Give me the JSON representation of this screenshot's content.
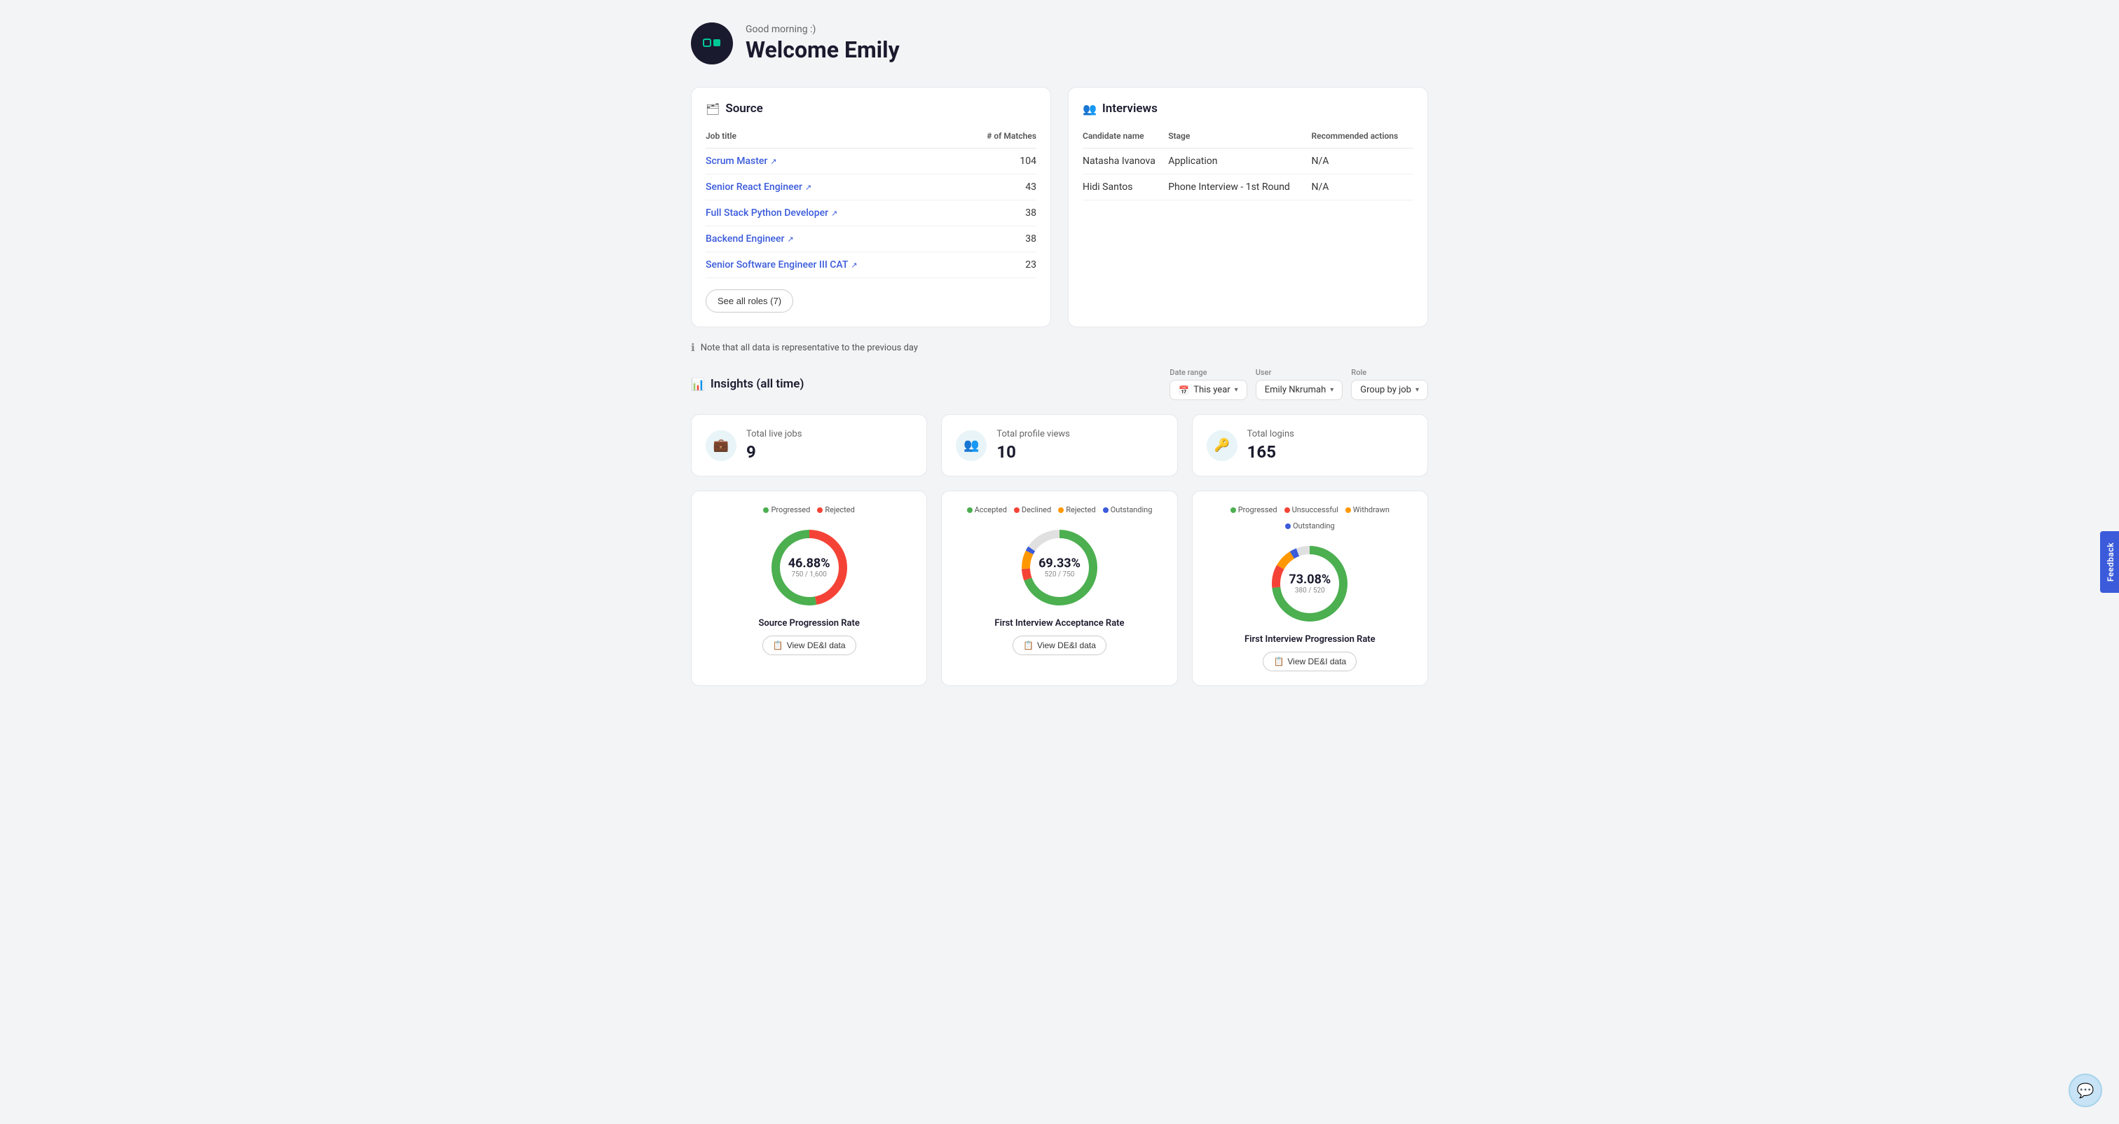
{
  "header": {
    "greeting": "Good morning :)",
    "welcome": "Welcome Emily",
    "logo_alt": "app logo"
  },
  "source_section": {
    "title": "Source",
    "table": {
      "col1": "Job title",
      "col2": "# of Matches",
      "rows": [
        {
          "title": "Scrum Master",
          "matches": "104"
        },
        {
          "title": "Senior React Engineer",
          "matches": "43"
        },
        {
          "title": "Full Stack Python Developer",
          "matches": "38"
        },
        {
          "title": "Backend Engineer",
          "matches": "38"
        },
        {
          "title": "Senior Software Engineer III CAT",
          "matches": "23"
        }
      ]
    },
    "see_all_btn": "See all roles (7)"
  },
  "interviews_section": {
    "title": "Interviews",
    "table": {
      "col1": "Candidate name",
      "col2": "Stage",
      "col3": "Recommended actions",
      "rows": [
        {
          "name": "Natasha Ivanova",
          "stage": "Application",
          "action": "N/A"
        },
        {
          "name": "Hidi Santos",
          "stage": "Phone Interview - 1st Round",
          "action": "N/A"
        }
      ]
    }
  },
  "note": "Note that all data is representative to the previous day",
  "insights": {
    "title": "Insights (all time)",
    "filters": {
      "date_range_label": "Date range",
      "date_range_value": "This year",
      "user_label": "User",
      "user_value": "Emily Nkrumah",
      "role_label": "Role",
      "role_value": "Group by job"
    },
    "stats": [
      {
        "label": "Total live jobs",
        "value": "9",
        "icon": "briefcase"
      },
      {
        "label": "Total profile views",
        "value": "10",
        "icon": "people"
      },
      {
        "label": "Total logins",
        "value": "165",
        "icon": "login"
      }
    ],
    "charts": [
      {
        "id": "source",
        "legend": [
          {
            "label": "Progressed",
            "color": "#4caf50"
          },
          {
            "label": "Rejected",
            "color": "#f44336"
          }
        ],
        "percentage": "46.88%",
        "sub": "750 / 1,600",
        "title": "Source Progression Rate",
        "btn": "View DE&I data",
        "segments": [
          {
            "pct": 46.88,
            "color": "#f44336"
          },
          {
            "pct": 53.12,
            "color": "#4caf50"
          }
        ]
      },
      {
        "id": "first_interview_acceptance",
        "legend": [
          {
            "label": "Accepted",
            "color": "#4caf50"
          },
          {
            "label": "Declined",
            "color": "#f44336"
          },
          {
            "label": "Rejected",
            "color": "#ff9800"
          },
          {
            "label": "Outstanding",
            "color": "#3b5bdb"
          }
        ],
        "percentage": "69.33%",
        "sub": "520 / 750",
        "title": "First Interview Acceptance Rate",
        "btn": "View DE&I data",
        "segments": [
          {
            "pct": 69.33,
            "color": "#4caf50"
          },
          {
            "pct": 5,
            "color": "#f44336"
          },
          {
            "pct": 8,
            "color": "#ff9800"
          },
          {
            "pct": 2,
            "color": "#3b5bdb"
          },
          {
            "pct": 15.67,
            "color": "#e0e0e0"
          }
        ]
      },
      {
        "id": "first_interview_progression",
        "legend": [
          {
            "label": "Progressed",
            "color": "#4caf50"
          },
          {
            "label": "Unsuccessful",
            "color": "#f44336"
          },
          {
            "label": "Withdrawn",
            "color": "#ff9800"
          },
          {
            "label": "Outstanding",
            "color": "#3b5bdb"
          }
        ],
        "percentage": "73.08%",
        "sub": "380 / 520",
        "title": "First Interview Progression Rate",
        "btn": "View DE&I data",
        "segments": [
          {
            "pct": 73.08,
            "color": "#4caf50"
          },
          {
            "pct": 10,
            "color": "#f44336"
          },
          {
            "pct": 8,
            "color": "#ff9800"
          },
          {
            "pct": 3,
            "color": "#3b5bdb"
          },
          {
            "pct": 5.92,
            "color": "#e0e0e0"
          }
        ]
      }
    ]
  },
  "feedback_tab": "Feedback",
  "chat_icon": "💬"
}
